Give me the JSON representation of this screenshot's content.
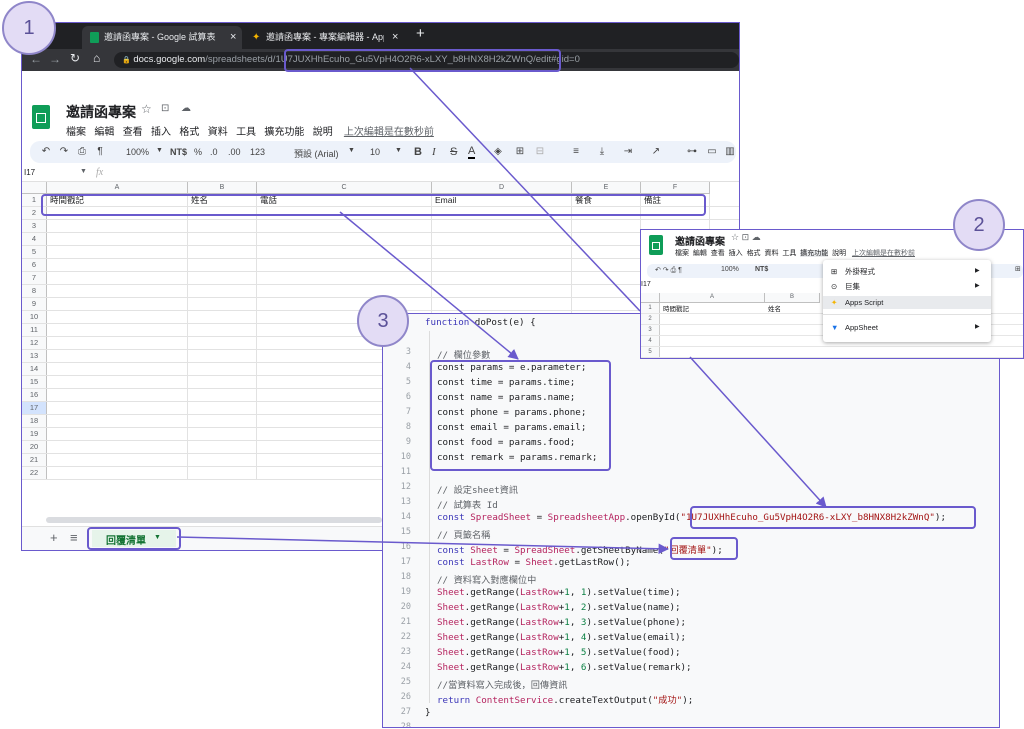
{
  "browser": {
    "tabs": [
      {
        "title": "邀請函專案 - Google 試算表",
        "close": "×"
      },
      {
        "title": "邀請函專案 - 專案編輯器 - Apps Sc",
        "close": "×"
      }
    ],
    "new_tab": "+",
    "url_prefix": "docs.google.com",
    "url_path_a": "/spreadsheets/d/",
    "url_id": "1U7JUXHhEcuho_Gu5VpH4O2R6-xLXY_b8HNX8H2kZWnQ",
    "url_path_b": "/edit#gid=0"
  },
  "sheet": {
    "doc_title": "邀請函專案",
    "menus": [
      "檔案",
      "編輯",
      "查看",
      "插入",
      "格式",
      "資料",
      "工具",
      "擴充功能",
      "說明"
    ],
    "last_edit": "上次編輯是在數秒前",
    "toolbar": {
      "zoom": "100%",
      "currency": "NT$",
      "percent": "%",
      "dec_less": ".0",
      "dec_more": ".00",
      "format": "123",
      "font": "預設 (Arial)",
      "size": "10"
    },
    "name_box": "I17",
    "fx": "fx",
    "columns": [
      "A",
      "B",
      "C",
      "D",
      "E",
      "F"
    ],
    "headers": [
      "時間戳記",
      "姓名",
      "電話",
      "Email",
      "餐食",
      "備註"
    ],
    "rows": [
      "1",
      "2",
      "3",
      "4",
      "5",
      "6",
      "7",
      "8",
      "9",
      "10",
      "11",
      "12",
      "13",
      "14",
      "15",
      "16",
      "17",
      "18",
      "19",
      "20",
      "21",
      "22"
    ],
    "sheet_tab": "回覆清單",
    "add": "+",
    "list": "≡"
  },
  "callouts": {
    "one": "1",
    "two": "2",
    "three": "3"
  },
  "inset": {
    "doc_title": "邀請函專案",
    "menus": [
      "檔案",
      "編輯",
      "查看",
      "插入",
      "格式",
      "資料",
      "工具",
      "擴充功能",
      "說明"
    ],
    "last_edit": "上次編輯是在數秒前",
    "zoom": "100%",
    "currency": "NT$",
    "name_box": "I17",
    "columns": [
      "A",
      "B"
    ],
    "headers": [
      "時間戳記",
      "姓名"
    ],
    "rows": [
      "1",
      "2",
      "3",
      "4",
      "5"
    ],
    "menu_items": [
      "外掛程式",
      "巨集",
      "Apps Script",
      "AppSheet"
    ]
  },
  "code": {
    "line_numbers": [
      "3",
      "4",
      "5",
      "6",
      "7",
      "8",
      "9",
      "10",
      "11",
      "12",
      "13",
      "14",
      "15",
      "16",
      "17",
      "18",
      "19",
      "20",
      "21",
      "22",
      "23",
      "24",
      "25",
      "26",
      "27",
      "28"
    ],
    "header": "function doPost(e) {",
    "c3": "// 欄位參數",
    "c12": "// 設定sheet資訊",
    "c13": "// 試算表 Id",
    "c15": "// 頁籤名稱",
    "c18": "// 資料寫入對應欄位中",
    "c25": "//當資料寫入完成後，回傳資訊",
    "params": [
      "const params = e.parameter;",
      "const time = params.time;",
      "const name = params.name;",
      "const phone = params.phone;",
      "const email = params.email;",
      "const food = params.food;",
      "const remark = params.remark;"
    ],
    "l14a": "const ",
    "l14b": "SpreadSheet",
    "l14c": " = ",
    "l14d": "SpreadsheetApp",
    "l14e": ".openById(",
    "l14str": "\"1U7JUXHhEcuho_Gu5VpH4O2R6-xLXY_b8HNX8H2kZWnQ\"",
    "l14end": ");",
    "l16a": "const ",
    "l16b": "Sheet",
    "l16c": " = ",
    "l16d": "SpreadSheet",
    "l16e": ".getSheetByName(",
    "l16str": "\"回覆清單\"",
    "l16end": ");",
    "l17a": "const ",
    "l17b": "LastRow",
    "l17c": " = ",
    "l17d": "Sheet",
    "l17e": ".getLastRow();",
    "setters": [
      {
        "n": "1",
        "v": "time"
      },
      {
        "n": "2",
        "v": "name"
      },
      {
        "n": "3",
        "v": "phone"
      },
      {
        "n": "4",
        "v": "email"
      },
      {
        "n": "5",
        "v": "food"
      },
      {
        "n": "6",
        "v": "remark"
      }
    ],
    "sheet_word": "Sheet",
    "getrange": ".getRange(",
    "lastrow_word": "LastRow",
    "plus": "+",
    "l26a": "return ",
    "l26b": "ContentService",
    "l26c": ".createTextOutput(",
    "l26str": "\"成功\"",
    "l26end": ");",
    "close_brace": "}"
  },
  "colors": {
    "accent": "#6a5acd",
    "callout_fill": "#e3dcf5",
    "sheets_green": "#0f9d58"
  }
}
